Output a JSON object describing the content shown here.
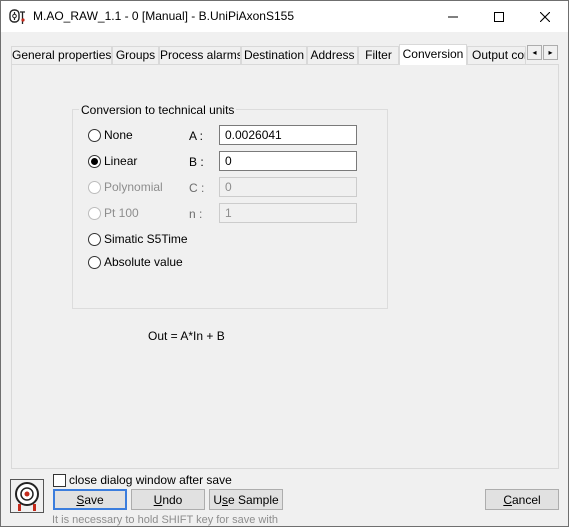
{
  "window": {
    "title": "M.AO_RAW_1.1 - 0 [Manual] - B.UniPiAxonS155",
    "app_icon": "plc-icon",
    "controls": {
      "minimize": "minimize-icon",
      "maximize": "maximize-icon",
      "close": "close-icon"
    }
  },
  "tabs": [
    {
      "label": "General properties",
      "active": false
    },
    {
      "label": "Groups",
      "active": false
    },
    {
      "label": "Process alarms",
      "active": false
    },
    {
      "label": "Destination",
      "active": false
    },
    {
      "label": "Address",
      "active": false
    },
    {
      "label": "Filter",
      "active": false
    },
    {
      "label": "Conversion",
      "active": true
    },
    {
      "label": "Output cor",
      "active": false
    }
  ],
  "tab_scroll": {
    "left": "◂",
    "right": "▸"
  },
  "conversion": {
    "group_title": "Conversion to technical units",
    "options": [
      {
        "label": "None",
        "checked": false,
        "enabled": true
      },
      {
        "label": "Linear",
        "checked": true,
        "enabled": true
      },
      {
        "label": "Polynomial",
        "checked": false,
        "enabled": false
      },
      {
        "label": "Pt 100",
        "checked": false,
        "enabled": false
      },
      {
        "label": "Simatic S5Time",
        "checked": false,
        "enabled": true
      },
      {
        "label": "Absolute value",
        "checked": false,
        "enabled": true
      }
    ],
    "params": [
      {
        "label": "A :",
        "value": "0.0026041",
        "enabled": true
      },
      {
        "label": "B :",
        "value": "0",
        "enabled": true
      },
      {
        "label": "C :",
        "value": "0",
        "enabled": false
      },
      {
        "label": "n :",
        "value": "1",
        "enabled": false
      }
    ],
    "formula": "Out = A*In + B"
  },
  "footer": {
    "close_after_save_label": "close dialog window after save",
    "close_after_save_checked": false,
    "buttons": {
      "save": {
        "mnemonic": "S",
        "rest": "ave"
      },
      "undo": {
        "mnemonic": "U",
        "rest": "ndo"
      },
      "use_sample": {
        "pre": "U",
        "mnemonic": "s",
        "rest": "e Sample"
      },
      "cancel": {
        "mnemonic": "C",
        "rest": "ancel"
      }
    },
    "hint": "It is necessary to hold SHIFT key for save with",
    "icon": "diagnostic-icon"
  },
  "colors": {
    "accent": "#3b7ddd",
    "disabled_text": "#8d8d8d",
    "close_red": "#c42b1c"
  }
}
